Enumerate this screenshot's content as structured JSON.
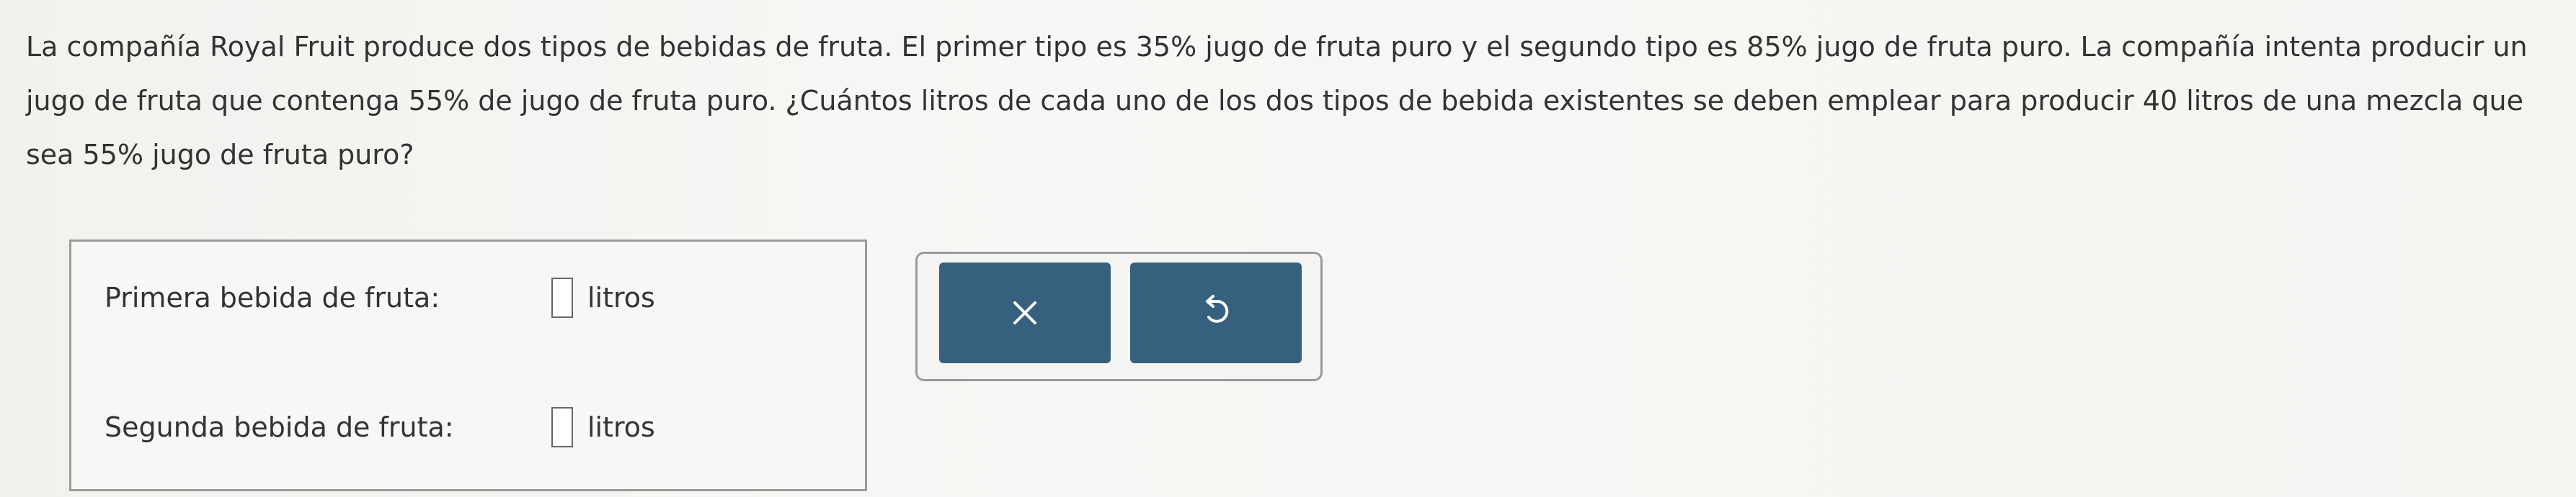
{
  "question": {
    "text": "La compañía Royal Fruit produce dos tipos de bebidas de fruta. El primer tipo es 35% jugo de fruta puro y el segundo tipo es 85% jugo de fruta puro. La compañía intenta producir un jugo de fruta que contenga 55% de jugo de fruta puro. ¿Cuántos litros de cada uno de los dos tipos de bebida existentes se deben emplear para producir 40 litros de una mezcla que sea 55% jugo de fruta puro?"
  },
  "answers": {
    "first": {
      "label": "Primera bebida de fruta:",
      "value": "",
      "unit": "litros"
    },
    "second": {
      "label": "Segunda bebida de fruta:",
      "value": "",
      "unit": "litros"
    }
  },
  "actions": {
    "clear_icon": "x-icon",
    "undo_icon": "undo-icon",
    "button_color": "#37607e"
  }
}
